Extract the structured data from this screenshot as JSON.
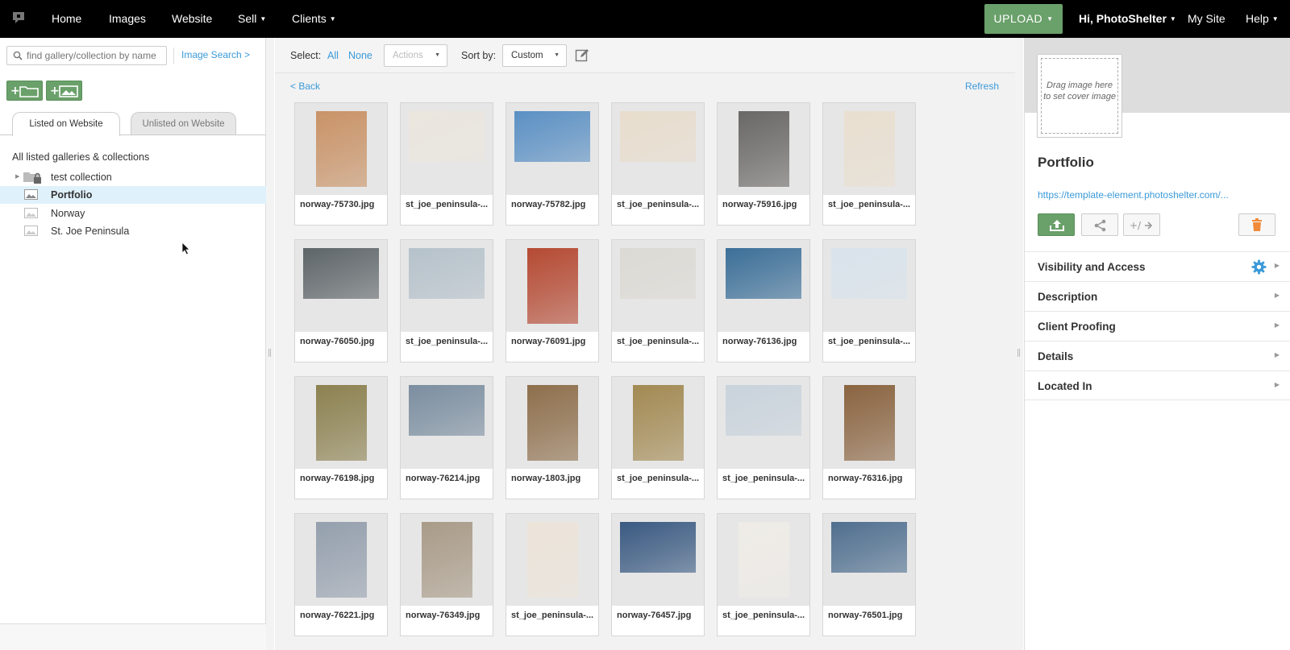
{
  "nav": {
    "home": "Home",
    "images": "Images",
    "website": "Website",
    "sell": "Sell",
    "clients": "Clients",
    "upload": "UPLOAD",
    "user": "Hi, PhotoShelter",
    "mysite": "My Site",
    "help": "Help"
  },
  "sidebar": {
    "search_placeholder": "find gallery/collection by name",
    "image_search": "Image Search >",
    "tabs": [
      "Listed on Website",
      "Unlisted on Website"
    ],
    "all_listed": "All listed galleries & collections",
    "items": [
      {
        "label": "test collection",
        "icon": "locked-collection-icon"
      },
      {
        "label": "Portfolio",
        "icon": "gallery-icon",
        "selected": true
      },
      {
        "label": "Norway",
        "icon": "gallery-icon"
      },
      {
        "label": "St. Joe Peninsula",
        "icon": "gallery-icon"
      }
    ]
  },
  "toolbar": {
    "select_label": "Select:",
    "all": "All",
    "none": "None",
    "actions": "Actions",
    "sort_label": "Sort by:",
    "sort_value": "Custom",
    "back": "< Back",
    "refresh": "Refresh"
  },
  "images": [
    {
      "name": "norway-75730.jpg",
      "color": "#c99367",
      "shape": "portrait"
    },
    {
      "name": "st_joe_peninsula-...",
      "color": "#ebe6de",
      "shape": "landscape"
    },
    {
      "name": "norway-75782.jpg",
      "color": "#5b90c4",
      "shape": "landscape"
    },
    {
      "name": "st_joe_peninsula-...",
      "color": "#e8ddcd",
      "shape": "landscape"
    },
    {
      "name": "norway-75916.jpg",
      "color": "#6a6866",
      "shape": "portrait"
    },
    {
      "name": "st_joe_peninsula-...",
      "color": "#e9dfd0",
      "shape": "portrait"
    },
    {
      "name": "norway-76050.jpg",
      "color": "#5e6569",
      "shape": "landscape"
    },
    {
      "name": "st_joe_peninsula-...",
      "color": "#b6c2cb",
      "shape": "landscape"
    },
    {
      "name": "norway-76091.jpg",
      "color": "#b54a33",
      "shape": "portrait"
    },
    {
      "name": "st_joe_peninsula-...",
      "color": "#dcdad4",
      "shape": "landscape"
    },
    {
      "name": "norway-76136.jpg",
      "color": "#3c6f98",
      "shape": "landscape"
    },
    {
      "name": "st_joe_peninsula-...",
      "color": "#d9e3ec",
      "shape": "landscape"
    },
    {
      "name": "norway-76198.jpg",
      "color": "#8c8150",
      "shape": "portrait"
    },
    {
      "name": "norway-76214.jpg",
      "color": "#7b8ea0",
      "shape": "landscape"
    },
    {
      "name": "norway-1803.jpg",
      "color": "#8e6f4c",
      "shape": "portrait"
    },
    {
      "name": "st_joe_peninsula-...",
      "color": "#a38a53",
      "shape": "portrait"
    },
    {
      "name": "st_joe_peninsula-...",
      "color": "#c9d3dc",
      "shape": "landscape"
    },
    {
      "name": "norway-76316.jpg",
      "color": "#8a6440",
      "shape": "portrait"
    },
    {
      "name": "norway-76221.jpg",
      "color": "#95a0ae",
      "shape": "portrait"
    },
    {
      "name": "norway-76349.jpg",
      "color": "#a99b88",
      "shape": "portrait"
    },
    {
      "name": "st_joe_peninsula-...",
      "color": "#ece4d9",
      "shape": "portrait"
    },
    {
      "name": "norway-76457.jpg",
      "color": "#3a5a82",
      "shape": "landscape"
    },
    {
      "name": "st_joe_peninsula-...",
      "color": "#efece7",
      "shape": "portrait"
    },
    {
      "name": "norway-76501.jpg",
      "color": "#4f6f8f",
      "shape": "landscape"
    }
  ],
  "right": {
    "cover_text": "Drag image here to set cover image",
    "title": "Portfolio",
    "url": "https://template-element.photoshelter.com/...",
    "sections": [
      "Visibility and Access",
      "Description",
      "Client Proofing",
      "Details",
      "Located In"
    ]
  },
  "colors": {
    "accent_green": "#6aa06a",
    "link_blue": "#3b9ad9",
    "selected_row": "#dff1fb",
    "delete_orange": "#f08a3a"
  }
}
